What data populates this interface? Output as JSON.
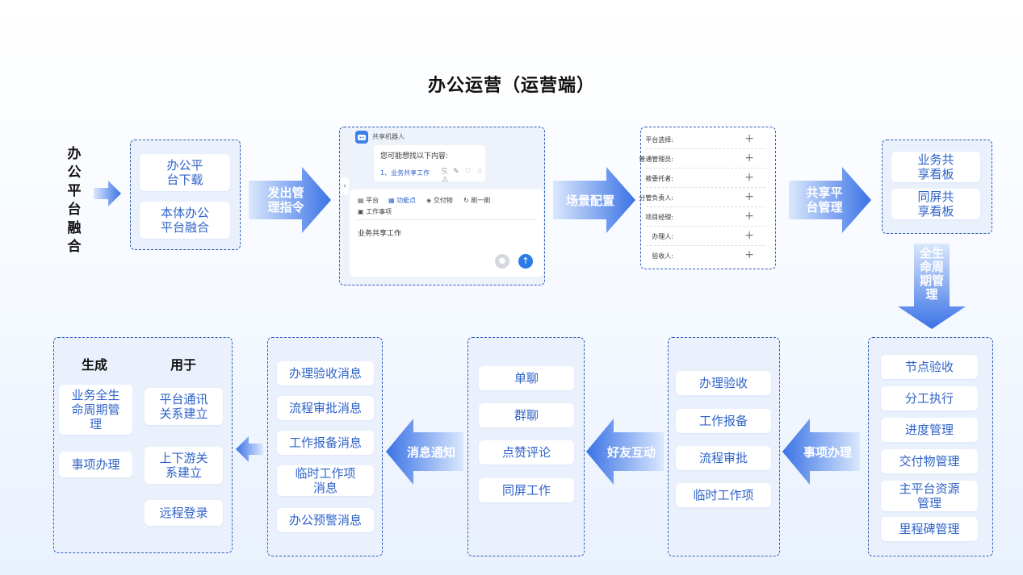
{
  "title": "办公运营（运营端）",
  "left_label": "办公平台融合",
  "download_box": {
    "items": [
      "办公平\n台下载",
      "本体办公\n平台融合"
    ]
  },
  "arrows": {
    "a1": "发出管\n理指令",
    "a2": "场景配置",
    "a3": "共享平\n台管理",
    "a4": "全生\n命周\n期管\n理",
    "a5": "事项办理",
    "a6": "好友互动",
    "a7": "消息通知"
  },
  "chat": {
    "bot_name": "共享机器人",
    "prompt": "您可能想找以下内容:",
    "suggestion": "1、业务共享工作",
    "tabs": [
      "平台",
      "功能点",
      "交付物",
      "刷一刷"
    ],
    "tab2": "工作事项",
    "input_text": "业务共享工作"
  },
  "form": {
    "fields": [
      "平台选择:",
      "普通管理员:",
      "被委托者:",
      "分管负责人:",
      "项目经理:",
      "办理人:",
      "验收人:"
    ]
  },
  "share_box": {
    "items": [
      "业务共\n享看板",
      "同屏共\n享看板"
    ]
  },
  "lifecycle_box": {
    "items": [
      "节点验收",
      "分工执行",
      "进度管理",
      "交付物管理",
      "主平台资源\n管理",
      "里程碑管理"
    ]
  },
  "matters_box": {
    "items": [
      "办理验收",
      "工作报备",
      "流程审批",
      "临时工作项"
    ]
  },
  "friends_box": {
    "items": [
      "单聊",
      "群聊",
      "点赞评论",
      "同屏工作"
    ]
  },
  "messages_box": {
    "items": [
      "办理验收消息",
      "流程审批消息",
      "工作报备消息",
      "临时工作项\n消息",
      "办公预警消息"
    ]
  },
  "result_box": {
    "col1_header": "生成",
    "col2_header": "用于",
    "col1": [
      "业务全生\n命周期管\n理",
      "事项办理"
    ],
    "col2": [
      "平台通讯\n关系建立",
      "上下游关\n系建立",
      "远程登录"
    ]
  },
  "colors": {
    "accent": "#2f63c8",
    "arrow_start": "#cfe0fb",
    "arrow_end": "#3a72e6"
  }
}
